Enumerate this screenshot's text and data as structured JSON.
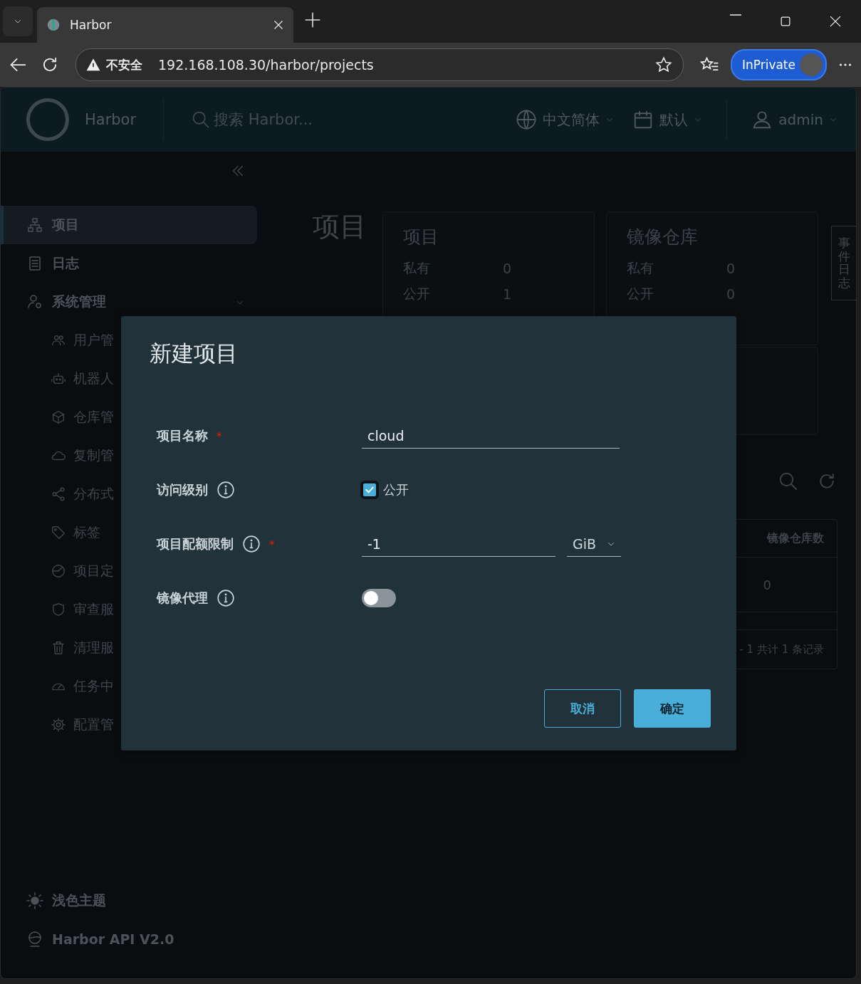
{
  "browser": {
    "tab_title": "Harbor",
    "security": "不安全",
    "url": "192.168.108.30/harbor/projects",
    "profile": "InPrivate"
  },
  "header": {
    "app_name": "Harbor",
    "search": {
      "placeholder": "搜索 Harbor..."
    },
    "language": "中文简体",
    "theme": "默认",
    "user": "admin"
  },
  "sidebar": {
    "items": [
      {
        "label": "项目",
        "selected": true
      },
      {
        "label": "日志",
        "selected": false
      },
      {
        "label": "系统管理",
        "selected": false,
        "expanded": true,
        "children": [
          {
            "label": "用户管"
          },
          {
            "label": "机器人"
          },
          {
            "label": "仓库管"
          },
          {
            "label": "复制管"
          },
          {
            "label": "分布式"
          },
          {
            "label": "标签"
          },
          {
            "label": "项目定"
          },
          {
            "label": "审查服"
          },
          {
            "label": "清理服"
          },
          {
            "label": "任务中"
          },
          {
            "label": "配置管"
          }
        ]
      }
    ],
    "footer": [
      "浅色主题",
      "Harbor API V2.0"
    ]
  },
  "page": {
    "title": "项目",
    "cards": [
      {
        "title": "项目",
        "rows": [
          {
            "label": "私有",
            "value": "0"
          },
          {
            "label": "公开",
            "value": "1"
          }
        ]
      },
      {
        "title": "镜像仓库",
        "rows": [
          {
            "label": "私有",
            "value": "0"
          },
          {
            "label": "公开",
            "value": "0"
          }
        ]
      }
    ],
    "event_tab": "事件日志",
    "table": {
      "column": "镜像仓库数",
      "cell": "0",
      "footer": "- 1 共计 1 条记录"
    }
  },
  "dialog": {
    "title": "新建项目",
    "fields": [
      {
        "kind": "text",
        "label": "项目名称",
        "required_mark": "*",
        "info": false,
        "value": "cloud"
      },
      {
        "kind": "checkbox",
        "label": "访问级别",
        "info": true,
        "checked": true,
        "option": "公开"
      },
      {
        "kind": "quota",
        "label": "项目配额限制",
        "required_mark": "*",
        "info": true,
        "value": "-1",
        "unit": "GiB"
      },
      {
        "kind": "toggle",
        "label": "镜像代理",
        "info": true,
        "on": false
      }
    ],
    "buttons": [
      {
        "label": "取消",
        "kind": "secondary"
      },
      {
        "label": "确定",
        "kind": "primary"
      }
    ]
  }
}
